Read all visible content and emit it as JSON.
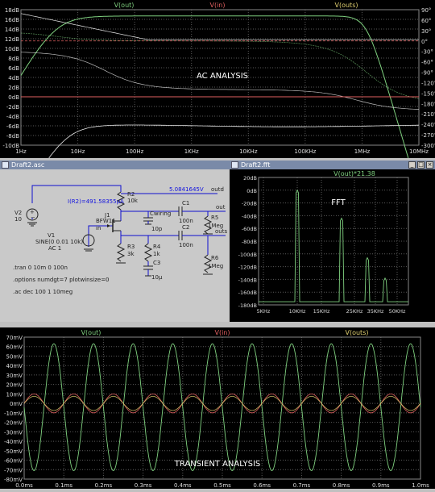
{
  "colors": {
    "bg": "#000000",
    "grid": "#5a5a5a",
    "green": "#7fd07f",
    "red": "#e06060",
    "yellow": "#e0d070",
    "white": "#e8e8e8",
    "schem_bg": "#c9c9c9",
    "wire": "#1010d0",
    "comp": "#222222",
    "label_blue": "#1010e0"
  },
  "ac": {
    "title": "AC ANALYSIS",
    "legend": [
      "V(out)",
      "V(in)",
      "V(outs)"
    ],
    "ylabels": [
      "18dB",
      "16dB",
      "14dB",
      "12dB",
      "10dB",
      "8dB",
      "6dB",
      "4dB",
      "2dB",
      "0dB",
      "-2dB",
      "-4dB",
      "-6dB",
      "-8dB",
      "-10dB"
    ],
    "phase_labels": [
      "90°",
      "60°",
      "30°",
      "0°",
      "-30°",
      "-60°",
      "-90°",
      "-120°",
      "-150°",
      "-180°",
      "-210°",
      "-240°",
      "-270°",
      "-300°"
    ],
    "xlabels": [
      "1Hz",
      "10Hz",
      "100Hz",
      "1KHz",
      "10KHz",
      "100KHz",
      "1MHz",
      "10MHz"
    ]
  },
  "schematic": {
    "title": "Draft2.asc",
    "v2_name": "V2",
    "v2_value": "10",
    "v1_name": "V1",
    "v1_value": "SINE(0 0.01 10k)",
    "v1_ac": "AC 1",
    "r2_name": "R2",
    "r2_value": "10k",
    "ir2": "I(R2)=491.58355µA",
    "j1_name": "J1",
    "j1_value": "BFW11",
    "node_in": "in",
    "cwiring_name": "Cwiring",
    "cwiring_value": "10p",
    "voltage_label": "5.0841645V",
    "node_outd": "outd",
    "node_out": "out",
    "node_outs": "outs",
    "c1_name": "C1",
    "c1_value": "100n",
    "r5_name": "R5",
    "r5_value": "1Meg",
    "r3_name": "R3",
    "r3_value": "3k",
    "r4_name": "R4",
    "r4_value": "1k",
    "c3_name": "C3",
    "c3_value": "10µ",
    "c2_name": "C2",
    "c2_value": "100n",
    "r6_name": "R6",
    "r6_value": "1Meg",
    "directives": [
      ".tran 0 10m 0 100n",
      ".options numdgt=7 plotwinsize=0",
      ".ac dec 100 1 10meg"
    ]
  },
  "fft": {
    "title": "Draft2.fft",
    "legend": "V(out)*21.38",
    "label": "FFT",
    "ylabels": [
      "20dB",
      "0dB",
      "-20dB",
      "-40dB",
      "-60dB",
      "-80dB",
      "-100dB",
      "-120dB",
      "-140dB",
      "-160dB",
      "-180dB"
    ],
    "xlabels": [
      "5KHz",
      "10KHz",
      "15KHz",
      "25KHz",
      "35KHz",
      "50KHz"
    ],
    "harmonic_peaks_db": [
      0,
      -44,
      -106,
      -138
    ]
  },
  "transient": {
    "title": "TRANSIENT ANALYSIS",
    "legend": [
      "V(out)",
      "V(in)",
      "V(outs)"
    ],
    "ylabels": [
      "70mV",
      "60mV",
      "50mV",
      "40mV",
      "30mV",
      "20mV",
      "10mV",
      "0mV",
      "-10mV",
      "-20mV",
      "-30mV",
      "-40mV",
      "-50mV",
      "-60mV",
      "-70mV",
      "-80mV"
    ],
    "xlabels": [
      "0.0ms",
      "0.1ms",
      "0.2ms",
      "0.3ms",
      "0.4ms",
      "0.5ms",
      "0.6ms",
      "0.7ms",
      "0.8ms",
      "0.9ms",
      "1.0ms"
    ],
    "out_amplitude_mv": 67,
    "in_amplitude_mv": 10,
    "frequency_khz": 10
  }
}
